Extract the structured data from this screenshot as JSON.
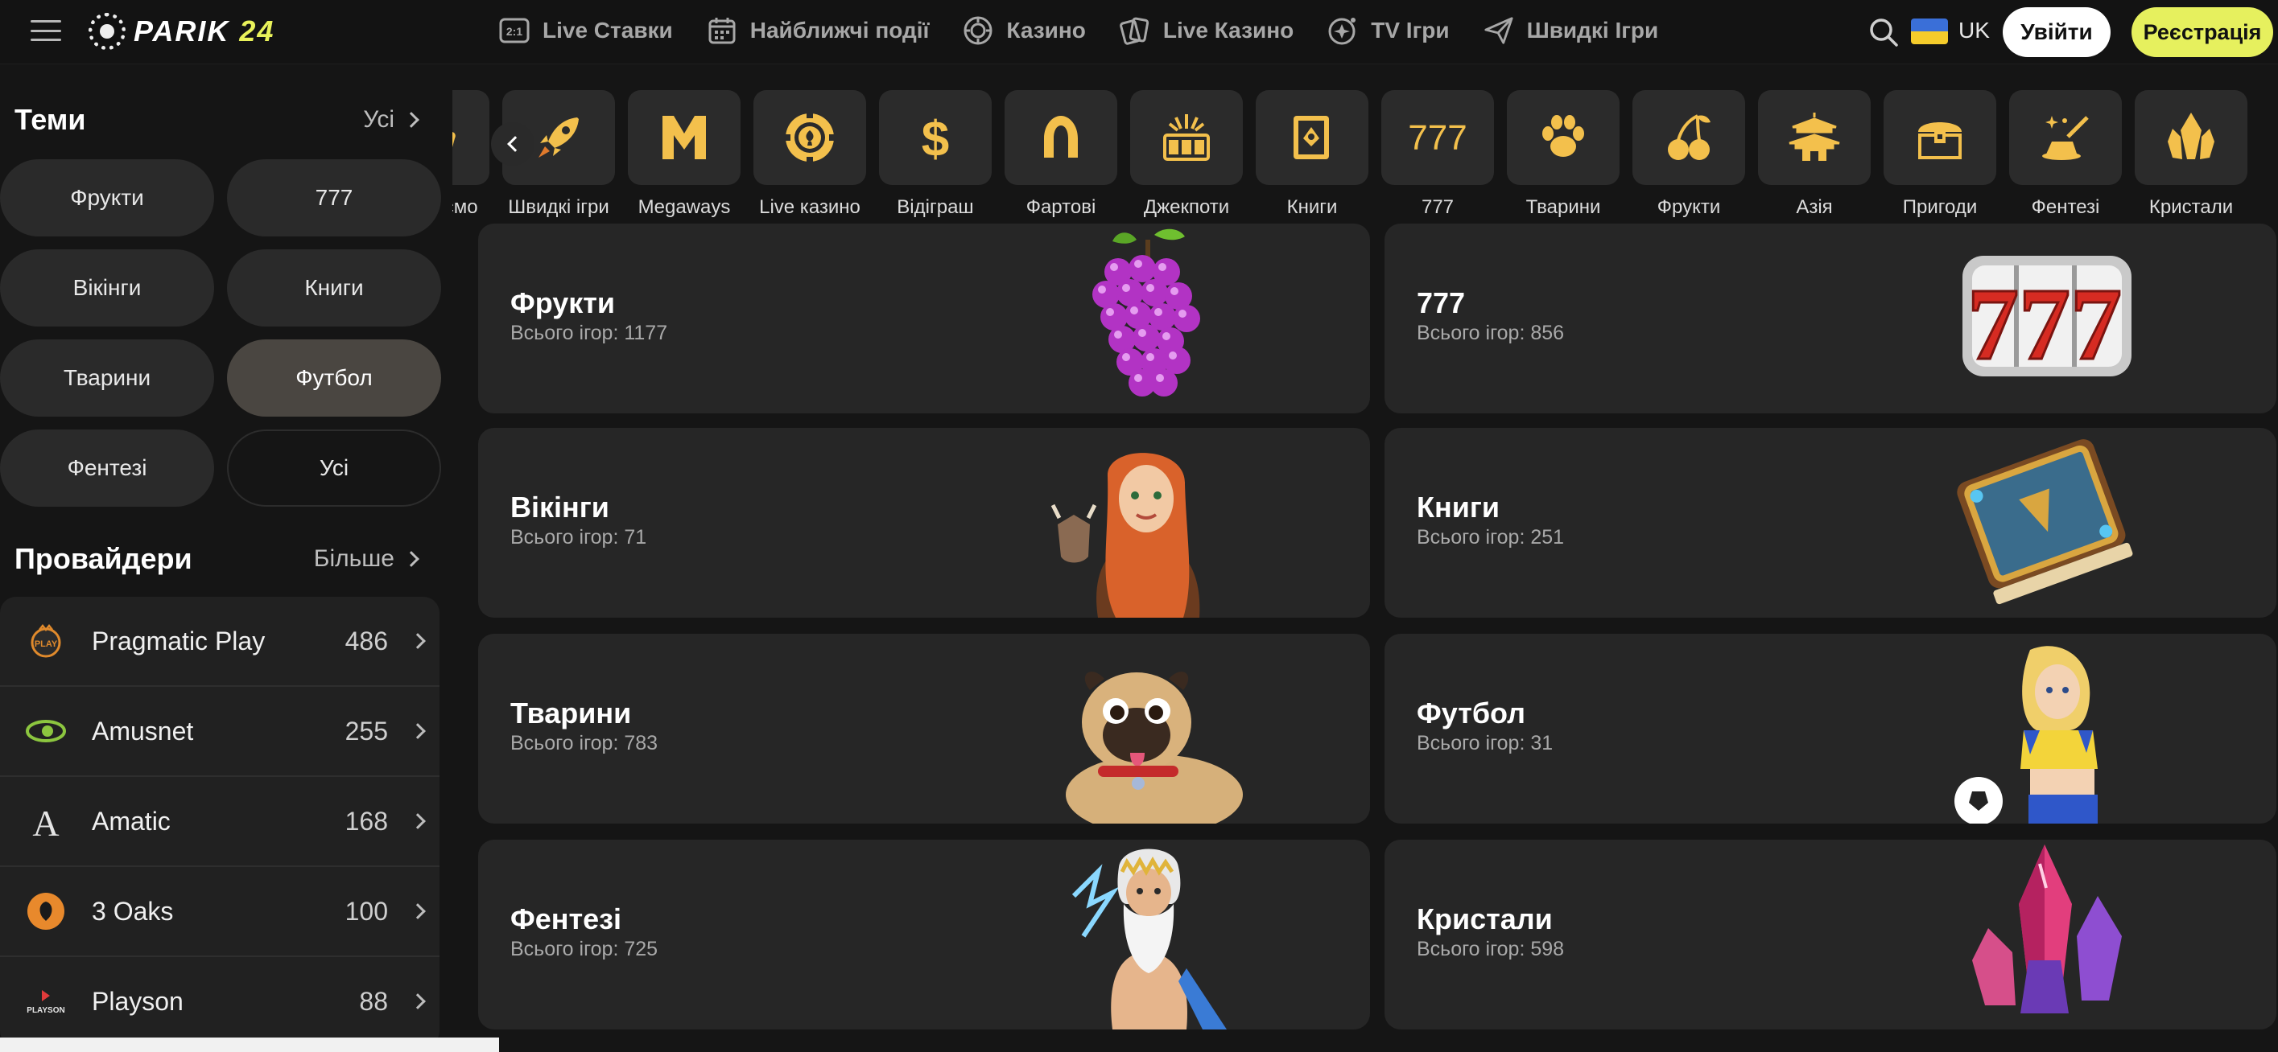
{
  "header": {
    "logo_text_main": "PARIK",
    "logo_text_num": "24",
    "nav": [
      {
        "label": "Live Ставки",
        "icon": "live-odds-icon"
      },
      {
        "label": "Найближчі події",
        "icon": "calendar-icon"
      },
      {
        "label": "Казино",
        "icon": "casino-chip-icon"
      },
      {
        "label": "Live Казино",
        "icon": "cards-icon"
      },
      {
        "label": "TV Ігри",
        "icon": "tv-games-icon"
      },
      {
        "label": "Швидкі Ігри",
        "icon": "plane-icon"
      }
    ],
    "lang": "UK",
    "login": "Увійти",
    "register": "Реєстрація"
  },
  "sidebar": {
    "themes_title": "Теми",
    "themes_all": "Усі",
    "themes": [
      "Фрукти",
      "777",
      "Вікінги",
      "Книги",
      "Тварини",
      "Футбол",
      "Фентезі",
      "Усі"
    ],
    "active_theme": "Футбол",
    "providers_title": "Провайдери",
    "providers_more": "Більше",
    "providers": [
      {
        "name": "Pragmatic Play",
        "count": "486"
      },
      {
        "name": "Amusnet",
        "count": "255"
      },
      {
        "name": "Amatic",
        "count": "168"
      },
      {
        "name": "3 Oaks",
        "count": "100"
      },
      {
        "name": "Playson",
        "count": "88"
      }
    ]
  },
  "categories": [
    {
      "label": "мендуємо",
      "icon": "thumb-icon"
    },
    {
      "label": "Швидкі ігри",
      "icon": "rocket-icon"
    },
    {
      "label": "Megaways",
      "icon": "megaways-icon"
    },
    {
      "label": "Live казино",
      "icon": "chip-icon"
    },
    {
      "label": "Відіграш",
      "icon": "dollar-icon"
    },
    {
      "label": "Фартові",
      "icon": "horseshoe-icon"
    },
    {
      "label": "Джекпоти",
      "icon": "jackpot-icon"
    },
    {
      "label": "Книги",
      "icon": "book-icon"
    },
    {
      "label": "777",
      "icon": "seven-icon"
    },
    {
      "label": "Тварини",
      "icon": "paw-icon"
    },
    {
      "label": "Фрукти",
      "icon": "cherry-icon"
    },
    {
      "label": "Азія",
      "icon": "pagoda-icon"
    },
    {
      "label": "Пригоди",
      "icon": "chest-icon"
    },
    {
      "label": "Фентезі",
      "icon": "magic-hat-icon"
    },
    {
      "label": "Кристали",
      "icon": "crystal-icon"
    }
  ],
  "cards": [
    {
      "title": "Фрукти",
      "sub": "Всього ігор: 1177",
      "art": "grapes"
    },
    {
      "title": "777",
      "sub": "Всього ігор: 856",
      "art": "sevens"
    },
    {
      "title": "Вікінги",
      "sub": "Всього ігор: 71",
      "art": "viking"
    },
    {
      "title": "Книги",
      "sub": "Всього ігор: 251",
      "art": "book"
    },
    {
      "title": "Тварини",
      "sub": "Всього ігор: 783",
      "art": "pug"
    },
    {
      "title": "Футбол",
      "sub": "Всього ігор: 31",
      "art": "footballer"
    },
    {
      "title": "Фентезі",
      "sub": "Всього ігор: 725",
      "art": "zeus"
    },
    {
      "title": "Кристали",
      "sub": "Всього ігор: 598",
      "art": "crystals"
    }
  ],
  "colors": {
    "accent": "#e6f05e",
    "gold": "#f3c04c",
    "bg": "#151515",
    "card": "#262626"
  }
}
